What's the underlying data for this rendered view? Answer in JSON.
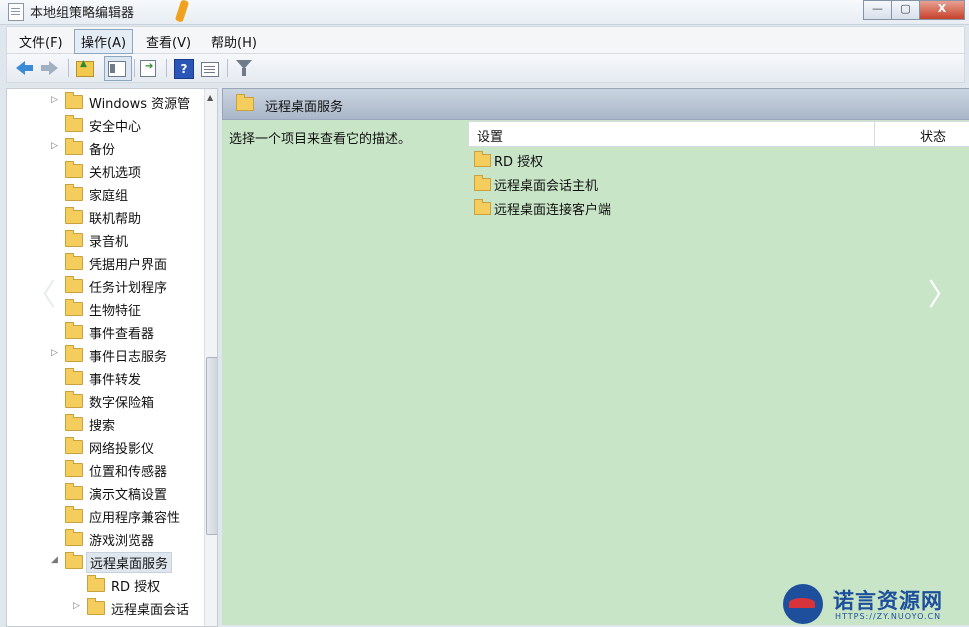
{
  "window": {
    "title": "本地组策略编辑器",
    "buttons": [
      "—",
      "▢",
      "X"
    ]
  },
  "menu": [
    "文件(F)",
    "操作(A)",
    "查看(V)",
    "帮助(H)"
  ],
  "toolbar": [
    "back-icon",
    "forward-icon",
    "up-icon",
    "show-hide-tree-icon",
    "export-list-icon",
    "help-icon",
    "properties-icon",
    "filter-icon"
  ],
  "tree": [
    {
      "label": "Windows 资源管",
      "expander": "▷"
    },
    {
      "label": "安全中心",
      "expander": ""
    },
    {
      "label": "备份",
      "expander": "▷"
    },
    {
      "label": "关机选项",
      "expander": ""
    },
    {
      "label": "家庭组",
      "expander": ""
    },
    {
      "label": "联机帮助",
      "expander": ""
    },
    {
      "label": "录音机",
      "expander": ""
    },
    {
      "label": "凭据用户界面",
      "expander": ""
    },
    {
      "label": "任务计划程序",
      "expander": ""
    },
    {
      "label": "生物特征",
      "expander": ""
    },
    {
      "label": "事件查看器",
      "expander": ""
    },
    {
      "label": "事件日志服务",
      "expander": "▷"
    },
    {
      "label": "事件转发",
      "expander": ""
    },
    {
      "label": "数字保险箱",
      "expander": ""
    },
    {
      "label": "搜索",
      "expander": ""
    },
    {
      "label": "网络投影仪",
      "expander": ""
    },
    {
      "label": "位置和传感器",
      "expander": ""
    },
    {
      "label": "演示文稿设置",
      "expander": ""
    },
    {
      "label": "应用程序兼容性",
      "expander": ""
    },
    {
      "label": "游戏浏览器",
      "expander": ""
    },
    {
      "label": "远程桌面服务",
      "expander": "◢"
    },
    {
      "label": "RD 授权",
      "expander": ""
    },
    {
      "label": "远程桌面会话",
      "expander": "▷"
    }
  ],
  "content": {
    "header": "远程桌面服务",
    "description": "选择一个项目来查看它的描述。",
    "columns": [
      "设置",
      "状态"
    ],
    "items": [
      "RD 授权",
      "远程桌面会话主机",
      "远程桌面连接客户端"
    ]
  },
  "overlay": {
    "prev": "〈",
    "next": "〉"
  },
  "watermark": {
    "name": "诺言资源网",
    "url": "HTTPS://ZY.NUOYO.CN"
  }
}
